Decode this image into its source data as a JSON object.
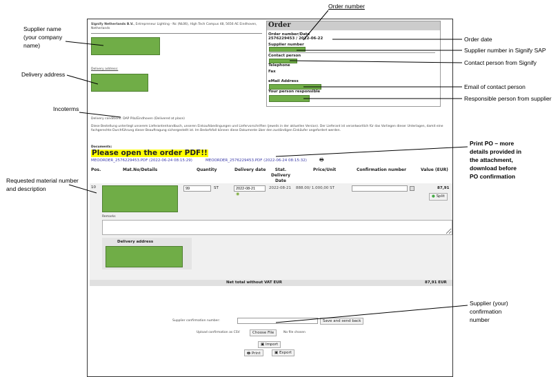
{
  "annotations": {
    "order_number": "Order number",
    "supplier_name": [
      "Supplier name",
      "(your company",
      "name)"
    ],
    "delivery_address": "Delivery address",
    "incoterms": "Incoterms",
    "order_date": "Order date",
    "supplier_number": "Supplier number in Signify SAP",
    "contact_person": "Contact person from Signify",
    "email": "Email of contact person",
    "responsible": "Responsible person from supplier",
    "print_po": [
      "Print PO – more",
      "details provided in",
      "the attachment,",
      "download before",
      "PO confirmation"
    ],
    "material": [
      "Requested material number",
      "and description"
    ],
    "confirmation": [
      "Supplier (your)",
      "confirmation",
      "number"
    ]
  },
  "header": {
    "company": "Signify Netherlands B.V.",
    "address": ", Entrepreneur Lighting - Nc (NL06), High Tech Campus 48, 5656 AE Eindhoven, Netherlands",
    "delivery_address_label": "Delivery address:"
  },
  "order": {
    "title": "Order",
    "number_date_label": "Order number/Date",
    "number_date": "2576229453 / 2022-06-22",
    "supplier_number_label": "Supplier number",
    "contact_person_label": "Contact person",
    "telephone_label": "Telephone",
    "fax_label": "Fax",
    "email_label": "eMail Address",
    "responsible_label": "Your person responsible"
  },
  "delivery_conditions": "Delivery conditions: DAP Pila/Eindhoven (Delivered at place)",
  "terms": "Diese Bestellung unterliegt unserem Lieferantenhandbuch, unseren Einkaufsbedingungen und Liefervorschriften (jeweils in der aktuellen Version). Der Lieferant ist verantwortlich für das Vorliegen dieser Unterlagen, damit eine fachgerechte Durchführung dieser Beauftragung sichergestellt ist. Im Bedarfsfall können diese Dokumente über den zuständigen Einkäufer angefordert werden.",
  "documents": {
    "label": "Documents:",
    "banner": "Please open the order PDF!!",
    "links": [
      "MEOORDER_2576229453.PDF (2022-06-24 08:15:29)",
      "MEOORDER_2576229453.PDF (2022-06-24 08:15:32)"
    ]
  },
  "table": {
    "headers": [
      "Pos.",
      "Mat.No/Details",
      "Quantity",
      "Delivery date",
      "Stat. Delivery Date",
      "Price/Unit",
      "Confirmation number",
      "Value (EUR)"
    ],
    "row": {
      "pos": "10",
      "quantity": "99",
      "unit": "ST",
      "delivery_date": "2022-08-21",
      "stat_date": "2022-08-21",
      "price": "888.00/ 1.000,00 ST",
      "confirmation": "",
      "value": "87,91",
      "split": "Split"
    },
    "remarks_label": "Remarks",
    "delivery_address_label": "Delivery address",
    "total_label": "Net total without VAT EUR",
    "total_value": "87,91 EUR"
  },
  "footer": {
    "confirmation_label": "Supplier confirmation number:",
    "confirmation_value": "",
    "save_button": "Save and send back",
    "upload_label": "Upload confirmation as CSV",
    "choose_file": "Choose File",
    "no_file": "No file chosen",
    "import": "Import",
    "print": "Print",
    "export": "Export"
  }
}
